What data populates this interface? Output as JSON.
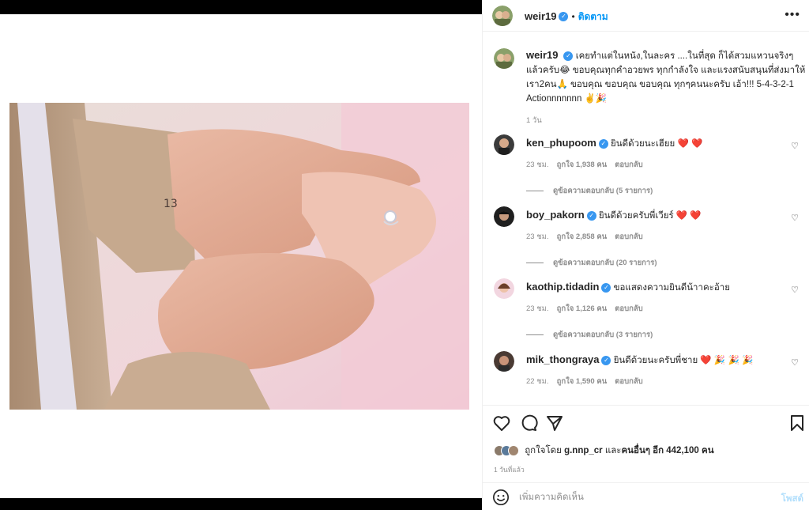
{
  "post": {
    "username": "weir19",
    "follow_label": "ติดตาม",
    "more_label": "•••",
    "caption": "เคยทำแต่ในหนัง,ในละคร ....ในที่สุด ก็ได้สวมแหวนจริงๆแล้วครับ😂 ขอบคุณทุกคำอวยพร ทุกกำลังใจ และแรงสนับสนุนที่ส่งมาให้เรา2คน🙏 ขอบคุณ ขอบคุณ ขอบคุณ ทุกๆคนนะครับ เอ้า!!! 5-4-3-2-1 Actionnnnnnn ✌️🎉",
    "caption_time": "1 วัน"
  },
  "comments": [
    {
      "username": "ken_phupoom",
      "text": "ยินดีด้วยนะเฮียย",
      "emoji": "❤️ ❤️",
      "time": "23 ชม.",
      "likes": "ถูกใจ 1,938 คน",
      "reply_label": "ตอบกลับ",
      "replies": "ดูข้อความตอบกลับ (5 รายการ)"
    },
    {
      "username": "boy_pakorn",
      "text": "ยินดีด้วยครับพี่เวียร์",
      "emoji": "❤️ ❤️",
      "time": "23 ชม.",
      "likes": "ถูกใจ 2,858 คน",
      "reply_label": "ตอบกลับ",
      "replies": "ดูข้อความตอบกลับ (20 รายการ)"
    },
    {
      "username": "kaothip.tidadin",
      "text": "ขอแสดงความยินดีน้าาคะอ้าย",
      "emoji": "",
      "time": "23 ชม.",
      "likes": "ถูกใจ 1,126 คน",
      "reply_label": "ตอบกลับ",
      "replies": "ดูข้อความตอบกลับ (3 รายการ)"
    },
    {
      "username": "mik_thongraya",
      "text": "ยินดีด้วยนะครับพี่ชาย",
      "emoji": "❤️ 🎉 🎉 🎉",
      "time": "22 ชม.",
      "likes": "ถูกใจ 1,590 คน",
      "reply_label": "ตอบกลับ",
      "replies": ""
    }
  ],
  "likes": {
    "prefix": "ถูกใจโดย",
    "user": "g.nnp_cr",
    "middle": "และ",
    "others": "คนอื่นๆ อีก 442,100 คน"
  },
  "posted_time": "1 วันที่แล้ว",
  "composer": {
    "placeholder": "เพิ่มความคิดเห็น",
    "post_label": "โพสต์"
  },
  "colors": {
    "accent": "#0095f6",
    "verified": "#3897f0",
    "heart": "#ed4956",
    "post_disabled": "#b2dffc"
  }
}
